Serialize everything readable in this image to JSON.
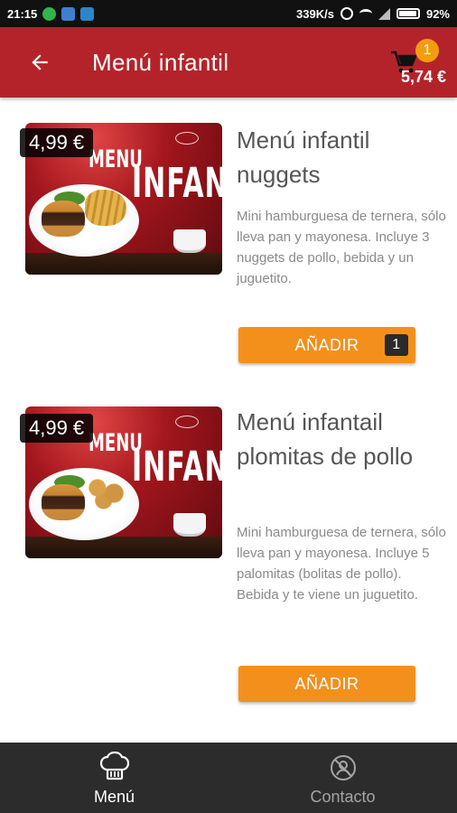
{
  "status_bar": {
    "time": "21:15",
    "network_speed": "339K/s",
    "battery": "92%"
  },
  "header": {
    "title": "Menú infantil",
    "cart_count": "1",
    "cart_total": "5,74 €"
  },
  "items": [
    {
      "price": "4,99 €",
      "title": "Menú infantil nuggets",
      "description": "Mini hamburguesa de ternera, sólo lleva pan y mayonesa. Incluye 3 nuggets de pollo, bebida y un juguetito.",
      "add_label": "AÑADIR",
      "quantity": "1",
      "image": {
        "heading_line1": "MENU",
        "heading_line2": "INFANTIL"
      }
    },
    {
      "price": "4,99 €",
      "title": "Menú infantail plomitas de pollo",
      "description": "Mini hamburguesa de ternera, sólo lleva pan y mayonesa. Incluye 5 palomitas (bolitas de pollo). Bebida y te viene un juguetito.",
      "add_label": "AÑADIR",
      "image": {
        "heading_line1": "MENU",
        "heading_line2": "INFANTIL"
      }
    }
  ],
  "bottom_nav": [
    {
      "label": "Menú",
      "icon": "chef-hat-icon",
      "active": true
    },
    {
      "label": "Contacto",
      "icon": "contact-icon",
      "active": false
    }
  ],
  "colors": {
    "header": "#b5232a",
    "accent": "#f3901b",
    "nav_background": "#2c2c2c"
  }
}
